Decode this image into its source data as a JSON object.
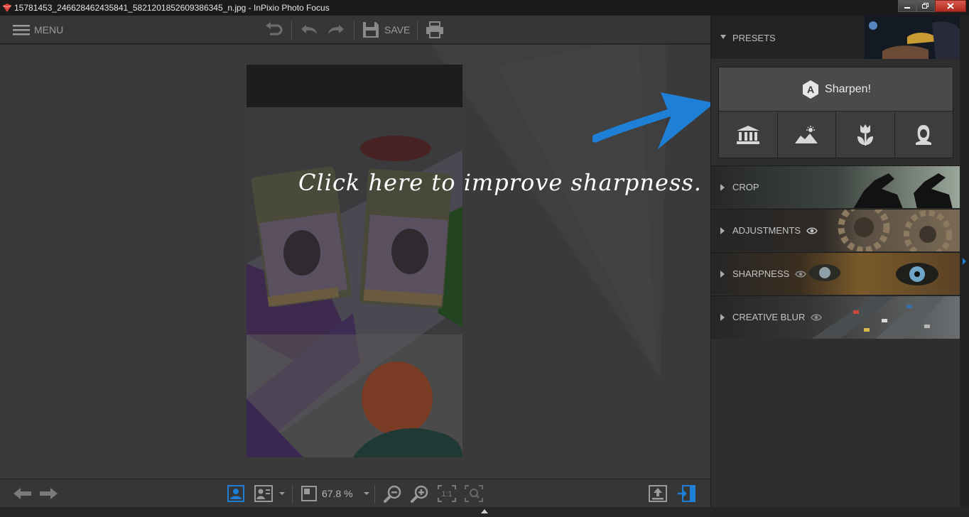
{
  "window": {
    "title": "15781453_246628462435841_5821201852609386345_n.jpg - InPixio Photo Focus",
    "minimize_icon": "minimize-icon",
    "maximize_icon": "maximize-icon",
    "close_icon": "close-icon"
  },
  "toolbar": {
    "menu_label": "MENU",
    "save_label": "SAVE"
  },
  "canvas": {
    "hint": "Click here to improve sharpness."
  },
  "bottombar": {
    "zoom": "67.8 %"
  },
  "panel": {
    "presets_label": "PRESETS",
    "sharpen_label": "Sharpen!",
    "sharpen_badge": "A",
    "sections": [
      {
        "label": "CROP"
      },
      {
        "label": "ADJUSTMENTS"
      },
      {
        "label": "SHARPNESS"
      },
      {
        "label": "CREATIVE BLUR"
      }
    ]
  },
  "colors": {
    "accent": "#1e7fd6",
    "panel_bg": "#2e2e2e",
    "canvas_bg": "#3a3a3a"
  }
}
